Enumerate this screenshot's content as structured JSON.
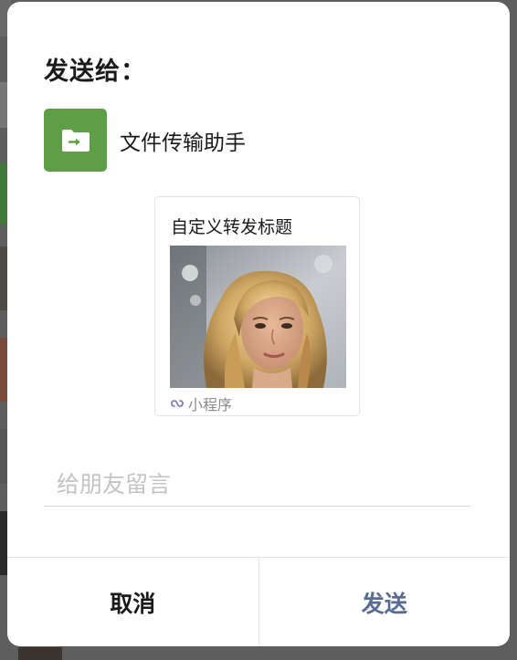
{
  "dialog": {
    "title": "发送给：",
    "recipient": {
      "name": "文件传输助手",
      "avatar_icon": "folder-arrow-icon",
      "avatar_color": "#5d9e47"
    },
    "card": {
      "title": "自定义转发标题",
      "image": "portrait-photo",
      "footer_icon": "mini-program-link-icon",
      "footer_label": "小程序"
    },
    "message": {
      "value": "",
      "placeholder": "给朋友留言"
    },
    "actions": {
      "cancel_label": "取消",
      "send_label": "发送",
      "send_color": "#576b95"
    }
  }
}
